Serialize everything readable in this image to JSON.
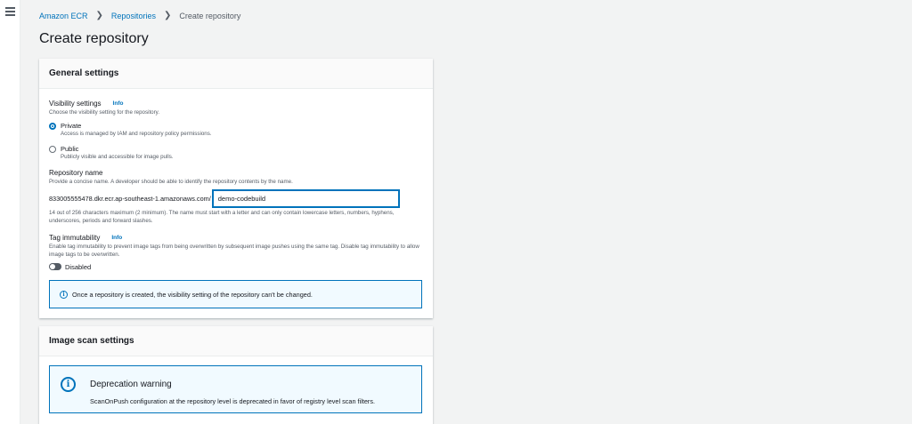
{
  "breadcrumb": {
    "root": "Amazon ECR",
    "parent": "Repositories",
    "current": "Create repository"
  },
  "page_title": "Create repository",
  "general": {
    "title": "General settings",
    "visibility": {
      "label": "Visibility settings",
      "info": "Info",
      "description": "Choose the visibility setting for the repository.",
      "selected": "Private",
      "options": [
        {
          "label": "Private",
          "description": "Access is managed by IAM and repository policy permissions."
        },
        {
          "label": "Public",
          "description": "Publicly visible and accessible for image pulls."
        }
      ]
    },
    "repo_name": {
      "label": "Repository name",
      "description": "Provide a concise name. A developer should be able to identify the repository contents by the name.",
      "prefix": "833005555478.dkr.ecr.ap-southeast-1.amazonaws.com/",
      "value": "demo-codebuild",
      "constraint": "14 out of 256 characters maximum (2 minimum). The name must start with a letter and can only contain lowercase letters, numbers, hyphens, underscores, periods and forward slashes."
    },
    "tag_immutability": {
      "label": "Tag immutability",
      "info": "Info",
      "description": "Enable tag immutability to prevent image tags from being overwritten by subsequent image pushes using the same tag. Disable tag immutability to allow image tags to be overwritten.",
      "state": "Disabled"
    },
    "alert": "Once a repository is created, the visibility setting of the repository can't be changed."
  },
  "scan": {
    "title": "Image scan settings",
    "warning_title": "Deprecation warning",
    "warning_text": "ScanOnPush configuration at the repository level is deprecated in favor of registry level scan filters."
  },
  "colors": {
    "accent": "#0073bb",
    "background": "#f2f3f3"
  }
}
